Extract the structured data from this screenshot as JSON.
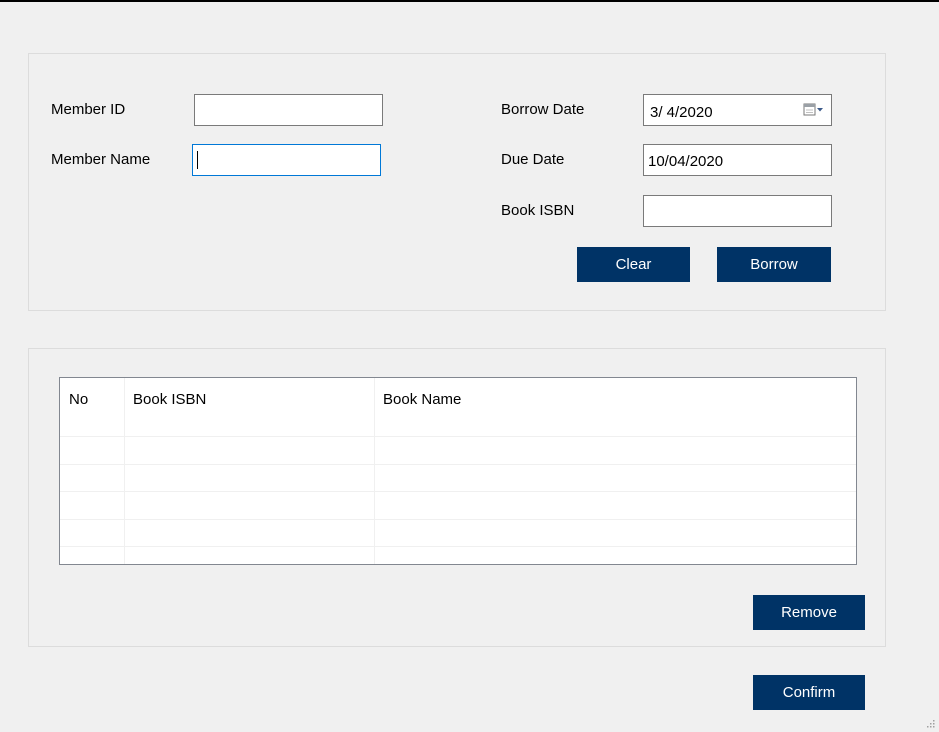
{
  "form": {
    "member_id_label": "Member ID",
    "member_id_value": "",
    "member_name_label": "Member Name",
    "member_name_value": "",
    "borrow_date_label": "Borrow Date",
    "borrow_date_value": "3/ 4/2020",
    "due_date_label": "Due Date",
    "due_date_value": "10/04/2020",
    "book_isbn_label": "Book ISBN",
    "book_isbn_value": "",
    "clear_label": "Clear",
    "borrow_label": "Borrow"
  },
  "table": {
    "columns": [
      "No",
      "Book ISBN",
      "Book Name"
    ],
    "rows": [
      {
        "no": "",
        "isbn": "",
        "name": ""
      },
      {
        "no": "",
        "isbn": "",
        "name": ""
      },
      {
        "no": "",
        "isbn": "",
        "name": ""
      },
      {
        "no": "",
        "isbn": "",
        "name": ""
      }
    ]
  },
  "actions": {
    "remove_label": "Remove",
    "confirm_label": "Confirm"
  },
  "colors": {
    "button_bg": "#003366",
    "window_bg": "#f0f0f0",
    "focus_border": "#0078d7"
  },
  "icons": {
    "calendar_dropdown": "calendar-dropdown-icon",
    "resize_grip": "resize-grip-icon"
  }
}
